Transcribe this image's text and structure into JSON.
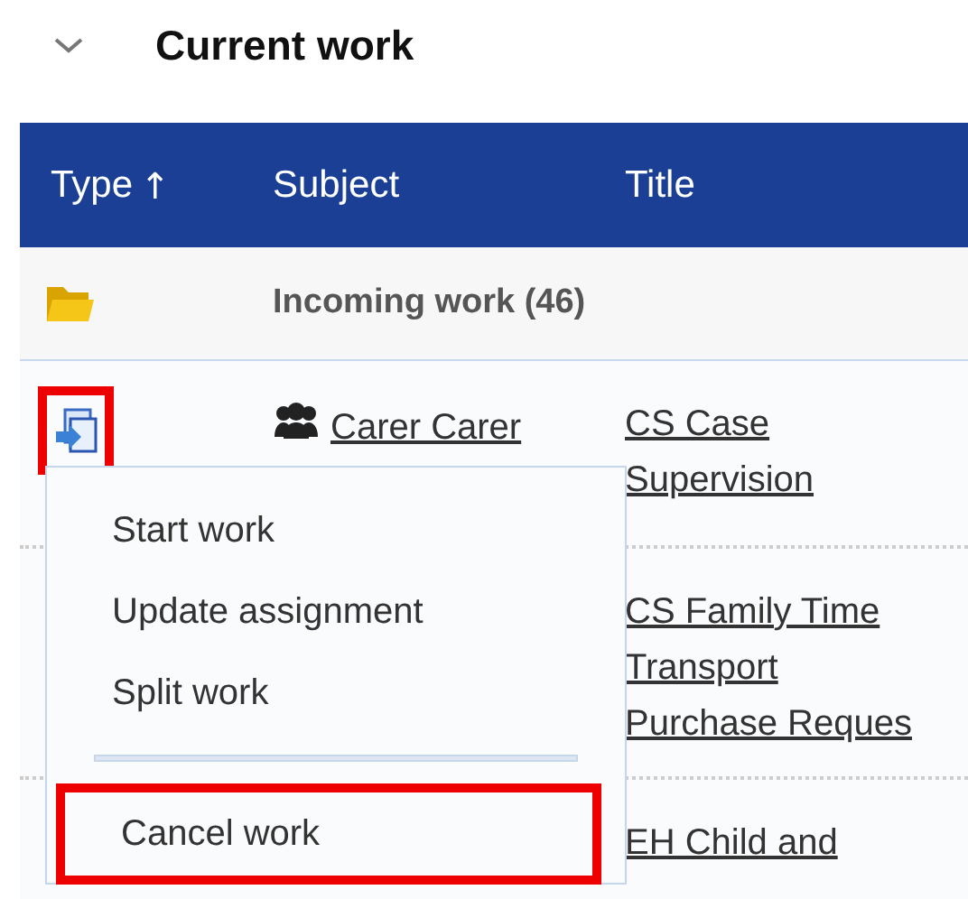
{
  "section": {
    "title": "Current work",
    "expanded": true
  },
  "table": {
    "columns": [
      {
        "label": "Type",
        "sort_icon": "↑"
      },
      {
        "label": "Subject"
      },
      {
        "label": "Title"
      }
    ],
    "group": {
      "label": "Incoming work (46)"
    },
    "rows": [
      {
        "highlighted": true,
        "subject": "Carer Carer",
        "title_lines": [
          "CS Case",
          "Supervision"
        ]
      },
      {
        "title_lines": [
          "CS Family Time",
          "Transport",
          "Purchase Reques"
        ]
      },
      {
        "title_lines": [
          "EH Child and"
        ]
      }
    ]
  },
  "menu": {
    "items": [
      {
        "label": "Start work",
        "highlighted": false,
        "separator_before": false
      },
      {
        "label": "Update assignment",
        "highlighted": false,
        "separator_before": false
      },
      {
        "label": "Split work",
        "highlighted": false,
        "separator_before": false
      },
      {
        "label": "Cancel work",
        "highlighted": true,
        "separator_before": true
      }
    ]
  }
}
